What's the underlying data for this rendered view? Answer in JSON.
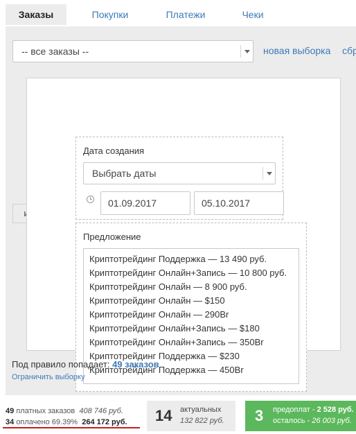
{
  "tabs": [
    {
      "label": "Заказы",
      "active": true
    },
    {
      "label": "Покупки",
      "active": false
    },
    {
      "label": "Платежи",
      "active": false
    },
    {
      "label": "Чеки",
      "active": false
    }
  ],
  "filter": {
    "select_value": "-- все заказы --",
    "new_selection_link": "новая выборка",
    "reset_link": "сбр"
  },
  "rules": {
    "and_button": "и",
    "date_block": {
      "label": "Дата создания",
      "select_value": "Выбрать даты",
      "date_from": "01.09.2017",
      "date_to": "05.10.2017"
    },
    "offer_block": {
      "label": "Предложение",
      "items": [
        "Криптотрейдинг Поддержка — 13 490 руб.",
        "Криптотрейдинг Онлайн+Запись — 10 800 руб.",
        "Криптотрейдинг Онлайн — 8 900 руб.",
        "Криптотрейдинг Онлайн — $150",
        "Криптотрейдинг Онлайн — 290Br",
        "Криптотрейдинг Онлайн+Запись — $180",
        "Криптотрейдинг Онлайн+Запись — 350Br",
        "Криптотрейдинг Поддержка — $230",
        "Криптотрейдинг Поддержка — 450Br"
      ]
    }
  },
  "match": {
    "prefix": "Под правило попадает:",
    "count": "49 заказов",
    "limit_link": "Ограничить выборку"
  },
  "stats": {
    "paid_orders_count": "49",
    "paid_orders_label": "платных заказов",
    "paid_orders_sum": "408 746 руб.",
    "paid_count": "34",
    "paid_label": "оплачено 69.39%",
    "paid_sum": "264 172 руб.",
    "actual_count": "14",
    "actual_label": "актуальных",
    "actual_sum": "132 822 руб.",
    "prepay_count": "3",
    "prepay_label": "предоплат -",
    "prepay_sum": "2 528 руб.",
    "remaining_label": "осталось -",
    "remaining_sum": "26 003 руб."
  },
  "colors": {
    "link": "#3d7ab8",
    "panel_bg": "#ececec",
    "prepay_bg": "#5cb85c",
    "underline": "#d01a1a"
  }
}
